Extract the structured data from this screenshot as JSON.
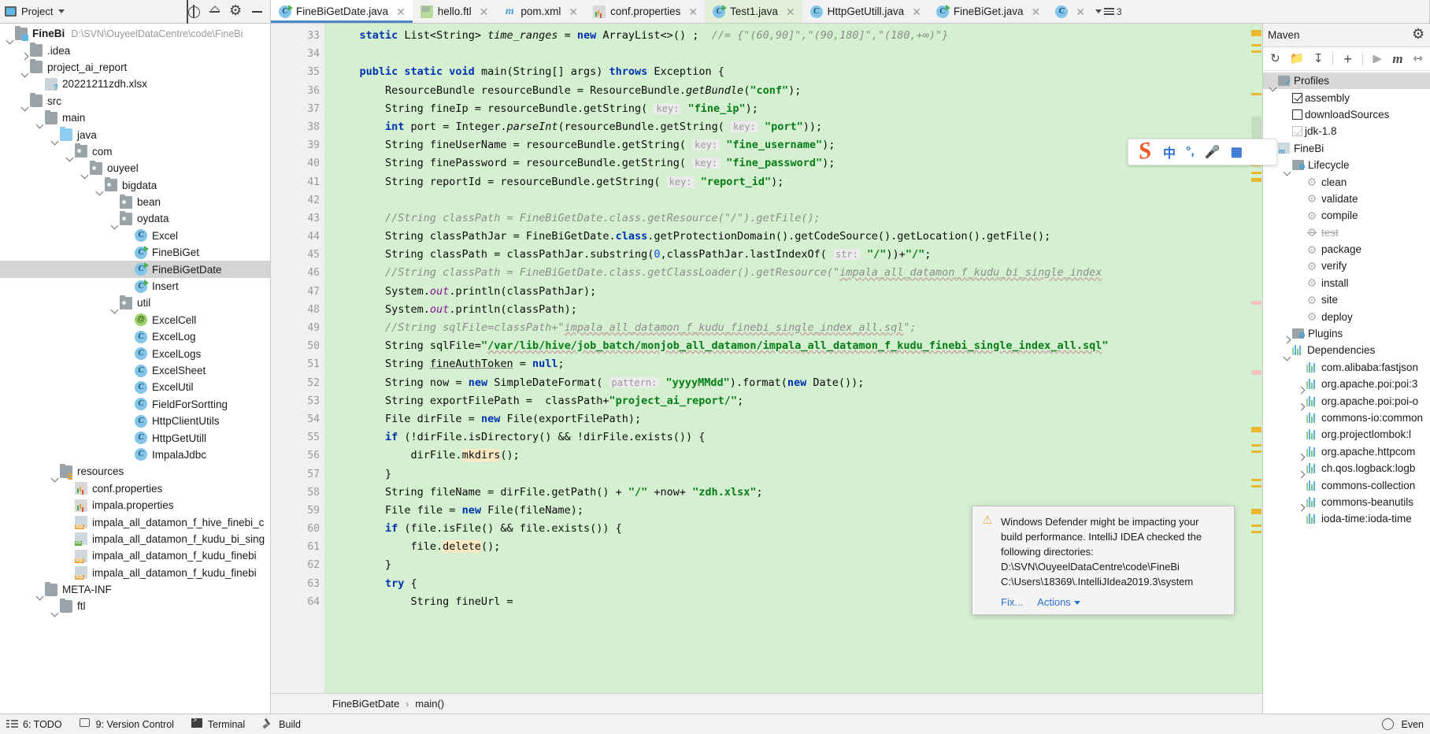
{
  "project_panel": {
    "title": "Project",
    "icons": [
      "locate-icon",
      "collapse-all-icon",
      "settings-icon",
      "hide-icon"
    ],
    "tree": [
      {
        "indent": 0,
        "arrow": "down",
        "icon": "module-icon",
        "label": "FineBi",
        "bold": true,
        "path": "D:\\SVN\\OuyeelDataCentre\\code\\FineBi"
      },
      {
        "indent": 1,
        "arrow": "right",
        "icon": "folder-icon",
        "label": ".idea"
      },
      {
        "indent": 1,
        "arrow": "down",
        "icon": "folder-icon",
        "label": "project_ai_report"
      },
      {
        "indent": 2,
        "arrow": "none",
        "icon": "xlsx-file-icon",
        "label": "20221211zdh.xlsx"
      },
      {
        "indent": 1,
        "arrow": "down",
        "icon": "folder-icon",
        "label": "src"
      },
      {
        "indent": 2,
        "arrow": "down",
        "icon": "folder-icon",
        "label": "main"
      },
      {
        "indent": 3,
        "arrow": "down",
        "icon": "source-folder-icon",
        "label": "java"
      },
      {
        "indent": 4,
        "arrow": "down",
        "icon": "package-icon",
        "label": "com"
      },
      {
        "indent": 5,
        "arrow": "down",
        "icon": "package-icon",
        "label": "ouyeel"
      },
      {
        "indent": 6,
        "arrow": "down",
        "icon": "package-icon",
        "label": "bigdata"
      },
      {
        "indent": 7,
        "arrow": "none",
        "icon": "package-icon",
        "label": "bean"
      },
      {
        "indent": 7,
        "arrow": "down",
        "icon": "package-icon",
        "label": "oydata"
      },
      {
        "indent": 8,
        "arrow": "none",
        "icon": "class-icon",
        "label": "Excel"
      },
      {
        "indent": 8,
        "arrow": "none",
        "icon": "class-runnable-icon",
        "label": "FineBiGet"
      },
      {
        "indent": 8,
        "arrow": "none",
        "icon": "class-runnable-icon",
        "label": "FineBiGetDate",
        "selected": true
      },
      {
        "indent": 8,
        "arrow": "none",
        "icon": "class-runnable-icon",
        "label": "Insert"
      },
      {
        "indent": 7,
        "arrow": "down",
        "icon": "package-icon",
        "label": "util"
      },
      {
        "indent": 8,
        "arrow": "none",
        "icon": "annotation-icon",
        "label": "ExcelCell"
      },
      {
        "indent": 8,
        "arrow": "none",
        "icon": "class-icon",
        "label": "ExcelLog"
      },
      {
        "indent": 8,
        "arrow": "none",
        "icon": "class-icon",
        "label": "ExcelLogs"
      },
      {
        "indent": 8,
        "arrow": "none",
        "icon": "class-icon",
        "label": "ExcelSheet"
      },
      {
        "indent": 8,
        "arrow": "none",
        "icon": "class-icon",
        "label": "ExcelUtil"
      },
      {
        "indent": 8,
        "arrow": "none",
        "icon": "class-icon",
        "label": "FieldForSortting"
      },
      {
        "indent": 8,
        "arrow": "none",
        "icon": "class-icon",
        "label": "HttpClientUtils"
      },
      {
        "indent": 8,
        "arrow": "none",
        "icon": "class-icon",
        "label": "HttpGetUtill"
      },
      {
        "indent": 8,
        "arrow": "none",
        "icon": "class-icon",
        "label": "ImpalaJdbc"
      },
      {
        "indent": 3,
        "arrow": "down",
        "icon": "resources-folder-icon",
        "label": "resources"
      },
      {
        "indent": 4,
        "arrow": "none",
        "icon": "properties-icon",
        "label": "conf.properties"
      },
      {
        "indent": 4,
        "arrow": "none",
        "icon": "properties-icon",
        "label": "impala.properties"
      },
      {
        "indent": 4,
        "arrow": "none",
        "icon": "sql-file-icon",
        "label": "impala_all_datamon_f_hive_finebi_c"
      },
      {
        "indent": 4,
        "arrow": "none",
        "icon": "sql-db-file-icon",
        "label": "impala_all_datamon_f_kudu_bi_sing"
      },
      {
        "indent": 4,
        "arrow": "none",
        "icon": "sql-file-icon",
        "label": "impala_all_datamon_f_kudu_finebi"
      },
      {
        "indent": 4,
        "arrow": "none",
        "icon": "sql-file-icon",
        "label": "impala_all_datamon_f_kudu_finebi"
      },
      {
        "indent": 2,
        "arrow": "down",
        "icon": "folder-icon",
        "label": "META-INF"
      },
      {
        "indent": 3,
        "arrow": "down",
        "icon": "folder-icon",
        "label": "ftl"
      }
    ]
  },
  "editor_tabs": [
    {
      "label": "FineBiGetDate.java",
      "icon": "class-runnable-icon",
      "state": "active"
    },
    {
      "label": "hello.ftl",
      "icon": "ftl-file-icon",
      "state": "normal"
    },
    {
      "label": "pom.xml",
      "icon": "maven-xml-icon",
      "state": "normal"
    },
    {
      "label": "conf.properties",
      "icon": "properties-icon",
      "state": "normal"
    },
    {
      "label": "Test1.java",
      "icon": "class-runnable-icon",
      "state": "highlighted"
    },
    {
      "label": "HttpGetUtill.java",
      "icon": "class-icon",
      "state": "normal"
    },
    {
      "label": "FineBiGet.java",
      "icon": "class-runnable-icon",
      "state": "normal"
    },
    {
      "label": "",
      "icon": "class-icon",
      "state": "normal"
    }
  ],
  "tabs_overflow_count": "3",
  "editor": {
    "first_line": 33,
    "lines": [
      {
        "n": 33,
        "html": "    <span class='kw'>static</span> List&lt;String&gt; <span class='it'>time_ranges</span> = <span class='kw'>new</span> ArrayList&lt;&gt;() ;  <span class='cm'>//= {\"(60,90]\",\"(90,180]\",\"(180,+&#8734;)\"}</span>"
      },
      {
        "n": 34,
        "html": ""
      },
      {
        "n": 35,
        "html": "    <span class='kw'>public static void</span> main(String[] args) <span class='kw'>throws</span> Exception {",
        "run": true,
        "fold": true
      },
      {
        "n": 36,
        "html": "        ResourceBundle resourceBundle = ResourceBundle.<span class='it'>getBundle</span>(<span class='st'>\"conf\"</span>);"
      },
      {
        "n": 37,
        "html": "        String fineIp = resourceBundle.getString( <span class='hint'>key:</span> <span class='st'>\"fine_ip\"</span>);"
      },
      {
        "n": 38,
        "html": "        <span class='kw'>int</span> port = Integer.<span class='it'>parseInt</span>(resourceBundle.getString( <span class='hint'>key:</span> <span class='st'>\"port\"</span>));"
      },
      {
        "n": 39,
        "html": "        String fineUserName = resourceBundle.getString( <span class='hint'>key:</span> <span class='st'>\"fine_username\"</span>);"
      },
      {
        "n": 40,
        "html": "        String finePassword = resourceBundle.getString( <span class='hint'>key:</span> <span class='st'>\"fine_password\"</span>);"
      },
      {
        "n": 41,
        "html": "        String reportId = resourceBundle.getString( <span class='hint'>key:</span> <span class='st'>\"report_id\"</span>);"
      },
      {
        "n": 42,
        "html": ""
      },
      {
        "n": 43,
        "html": "        <span class='cm'>//String classPath = FineBiGetDate.class.getResource(\"/\").getFile();</span>"
      },
      {
        "n": 44,
        "html": "        String classPathJar = FineBiGetDate.<span class='kw'>class</span>.getProtectionDomain().getCodeSource().getLocation().getFile();"
      },
      {
        "n": 45,
        "html": "        String classPath = classPathJar.substring(<span class='num'>0</span>,classPathJar.lastIndexOf( <span class='hint'>str:</span> <span class='st'>\"/\"</span>))+<span class='st'>\"/\"</span>;"
      },
      {
        "n": 46,
        "html": "        <span class='cm'>//String classPath = FineBiGetDate.class.getClassLoader().getResource(\"<span class='sq'>impala_all_datamon_f_kudu_bi_single_index</span>"
      },
      {
        "n": 47,
        "html": "        System.<span class='fld'>out</span>.println(classPathJar);"
      },
      {
        "n": 48,
        "html": "        System.<span class='fld'>out</span>.println(classPath);"
      },
      {
        "n": 49,
        "html": "        <span class='cm'>//String sqlFile=classPath+\"<span class='sq'>impala_all_datamon_f_kudu_finebi_single_index_all.sql</span>\";</span>"
      },
      {
        "n": 50,
        "html": "        String sqlFile=<span class='st'>\"<span class='sq'>/var/lib/hive/job_batch/monjob_all_datamon/impala_all_datamon_f_kudu_finebi_single_index_all.sql</span>\"</span>"
      },
      {
        "n": 51,
        "html": "        String <span class='und'>fineAuthToken</span> = <span class='kw'>null</span>;"
      },
      {
        "n": 52,
        "html": "        String now = <span class='kw'>new</span> SimpleDateFormat( <span class='hint'>pattern:</span> <span class='st'>\"yyyyMMdd\"</span>).format(<span class='kw'>new</span> Date());"
      },
      {
        "n": 53,
        "html": "        String exportFilePath =  classPath+<span class='st'>\"project_ai_report/\"</span>;"
      },
      {
        "n": 54,
        "html": "        File dirFile = <span class='kw'>new</span> File(exportFilePath);"
      },
      {
        "n": 55,
        "html": "        <span class='kw'>if</span> (!dirFile.isDirectory() &amp;&amp; !dirFile.exists()) {",
        "fold": true
      },
      {
        "n": 56,
        "html": "            dirFile.<span class='hl'>mkdirs</span>();"
      },
      {
        "n": 57,
        "html": "        }"
      },
      {
        "n": 58,
        "html": "        String fileName = dirFile.getPath() + <span class='st'>\"/\"</span> +now+ <span class='st'>\"zdh.xlsx\"</span>;"
      },
      {
        "n": 59,
        "html": "        File file = <span class='kw'>new</span> File(fileName);"
      },
      {
        "n": 60,
        "html": "        <span class='kw'>if</span> (file.isFile() &amp;&amp; file.exists()) {",
        "fold": true
      },
      {
        "n": 61,
        "html": "            file.<span class='hl'>delete</span>();"
      },
      {
        "n": 62,
        "html": "        }"
      },
      {
        "n": 63,
        "html": "        <span class='kw'>try</span> {",
        "fold": true
      },
      {
        "n": 64,
        "html": "            String fineUrl ="
      }
    ],
    "breadcrumb": {
      "file": "FineBiGetDate",
      "method": "main()"
    }
  },
  "maven_panel": {
    "title": "Maven",
    "toolbar_icons": [
      "reload-icon",
      "add-maven-project-icon",
      "download-sources-icon",
      "add-icon",
      "run-icon",
      "execute-maven-goal-icon",
      "toggle-offline-icon"
    ],
    "tree": [
      {
        "indent": 0,
        "arrow": "down",
        "type": "profiles",
        "label": "Profiles",
        "selected": true
      },
      {
        "indent": 1,
        "arrow": "none",
        "type": "checkbox",
        "label": "assembly",
        "checked": true
      },
      {
        "indent": 1,
        "arrow": "none",
        "type": "checkbox",
        "label": "downloadSources",
        "checked": false
      },
      {
        "indent": 1,
        "arrow": "none",
        "type": "checkbox",
        "label": "jdk-1.8",
        "checked": true,
        "disabled": true
      },
      {
        "indent": 0,
        "arrow": "down",
        "type": "maven",
        "label": "FineBi"
      },
      {
        "indent": 1,
        "arrow": "down",
        "type": "folder-cfg",
        "label": "Lifecycle"
      },
      {
        "indent": 2,
        "arrow": "none",
        "type": "goal",
        "label": "clean"
      },
      {
        "indent": 2,
        "arrow": "none",
        "type": "goal",
        "label": "validate"
      },
      {
        "indent": 2,
        "arrow": "none",
        "type": "goal",
        "label": "compile"
      },
      {
        "indent": 2,
        "arrow": "none",
        "type": "goal",
        "label": "test",
        "dim": true
      },
      {
        "indent": 2,
        "arrow": "none",
        "type": "goal",
        "label": "package"
      },
      {
        "indent": 2,
        "arrow": "none",
        "type": "goal",
        "label": "verify"
      },
      {
        "indent": 2,
        "arrow": "none",
        "type": "goal",
        "label": "install"
      },
      {
        "indent": 2,
        "arrow": "none",
        "type": "goal",
        "label": "site"
      },
      {
        "indent": 2,
        "arrow": "none",
        "type": "goal",
        "label": "deploy"
      },
      {
        "indent": 1,
        "arrow": "right",
        "type": "folder-cfg",
        "label": "Plugins"
      },
      {
        "indent": 1,
        "arrow": "down",
        "type": "deps",
        "label": "Dependencies"
      },
      {
        "indent": 2,
        "arrow": "none",
        "type": "dep",
        "label": "com.alibaba:fastjson"
      },
      {
        "indent": 2,
        "arrow": "right",
        "type": "dep",
        "label": "org.apache.poi:poi:3"
      },
      {
        "indent": 2,
        "arrow": "right",
        "type": "dep",
        "label": "org.apache.poi:poi-o"
      },
      {
        "indent": 2,
        "arrow": "none",
        "type": "dep",
        "label": "commons-io:common"
      },
      {
        "indent": 2,
        "arrow": "none",
        "type": "dep",
        "label": "org.projectlombok:l"
      },
      {
        "indent": 2,
        "arrow": "right",
        "type": "dep",
        "label": "org.apache.httpcom"
      },
      {
        "indent": 2,
        "arrow": "right",
        "type": "dep",
        "label": "ch.qos.logback:logb"
      },
      {
        "indent": 2,
        "arrow": "none",
        "type": "dep",
        "label": "commons-collection"
      },
      {
        "indent": 2,
        "arrow": "right",
        "type": "dep",
        "label": "commons-beanutils"
      },
      {
        "indent": 2,
        "arrow": "none",
        "type": "dep",
        "label": "ioda-time:ioda-time"
      }
    ]
  },
  "ime_bar": {
    "logo": "sogou-logo-icon",
    "items": [
      "chinese-mode-icon",
      "punctuation-icon",
      "microphone-icon",
      "keyboard-icon"
    ]
  },
  "notification": {
    "icon": "warning-icon",
    "lines": [
      "Windows Defender might be impacting your",
      "build performance. IntelliJ IDEA checked the",
      "following directories:",
      "D:\\SVN\\OuyeelDataCentre\\code\\FineBi",
      "C:\\Users\\18369\\.IntelliJIdea2019.3\\system"
    ],
    "actions": [
      {
        "label": "Fix...",
        "dropdown": false
      },
      {
        "label": "Actions",
        "dropdown": true
      }
    ]
  },
  "status_bar": {
    "items": [
      {
        "label": "6: TODO",
        "icon": "todo-icon"
      },
      {
        "label": "9: Version Control",
        "icon": "vcs-icon"
      },
      {
        "label": "Terminal",
        "icon": "terminal-icon"
      },
      {
        "label": "Build",
        "icon": "build-icon"
      }
    ],
    "right": {
      "label": "Even",
      "icon": "event-log-icon"
    }
  }
}
